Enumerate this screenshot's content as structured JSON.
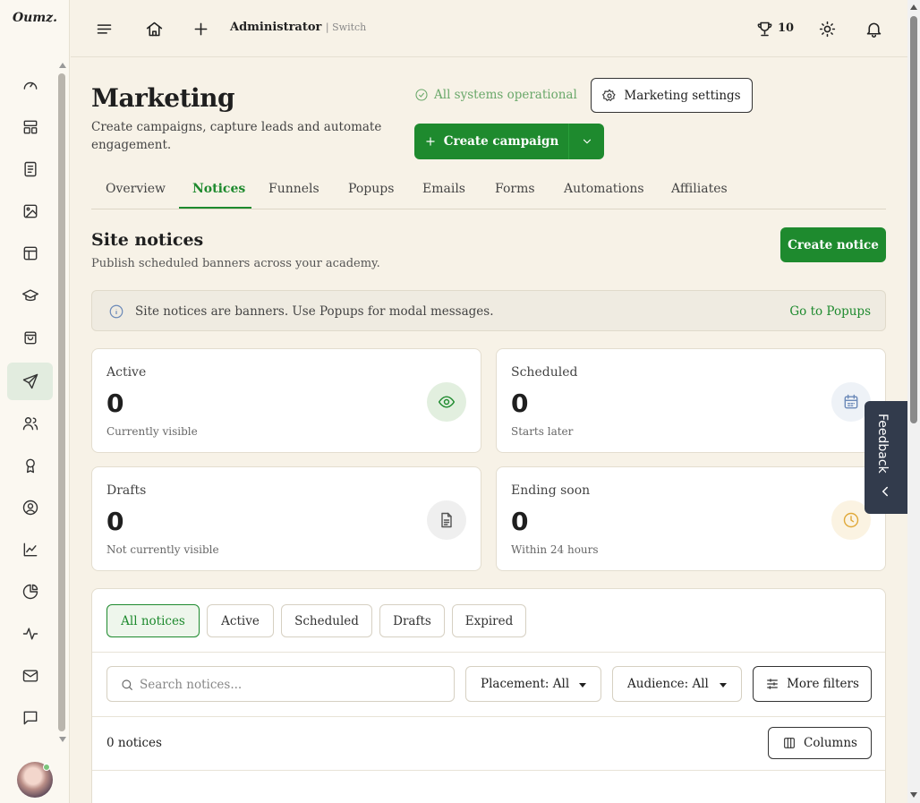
{
  "app": {
    "logo_text": "Oumz."
  },
  "topbar": {
    "user_name": "Administrator",
    "switch_label": "| Switch",
    "trophy_count": "10"
  },
  "header": {
    "title": "Marketing",
    "subtitle": "Create campaigns, capture leads and automate engagement.",
    "status_text": "All systems operational",
    "settings_label": "Marketing settings",
    "create_campaign_label": "Create campaign"
  },
  "tabs": [
    {
      "label": "Overview"
    },
    {
      "label": "Notices"
    },
    {
      "label": "Funnels"
    },
    {
      "label": "Popups"
    },
    {
      "label": "Emails"
    },
    {
      "label": "Forms"
    },
    {
      "label": "Automations"
    },
    {
      "label": "Affiliates"
    }
  ],
  "section": {
    "title": "Site notices",
    "subtitle": "Publish scheduled banners across your academy.",
    "create_label": "Create notice"
  },
  "info": {
    "text": "Site notices are banners. Use Popups for modal messages.",
    "link": "Go to Popups"
  },
  "stats": [
    {
      "label": "Active",
      "value": "0",
      "note": "Currently visible",
      "icon": "eye-icon",
      "color": "#1e8a2e"
    },
    {
      "label": "Scheduled",
      "value": "0",
      "note": "Starts later",
      "icon": "calendar-icon",
      "color": "#6b89b8"
    },
    {
      "label": "Drafts",
      "value": "0",
      "note": "Not currently visible",
      "icon": "document-icon",
      "color": "#555555"
    },
    {
      "label": "Ending soon",
      "value": "0",
      "note": "Within 24 hours",
      "icon": "clock-icon",
      "color": "#e0a93a"
    }
  ],
  "feedback": {
    "label": "Feedback"
  },
  "notices": {
    "filters": [
      {
        "label": "All notices"
      },
      {
        "label": "Active"
      },
      {
        "label": "Scheduled"
      },
      {
        "label": "Drafts"
      },
      {
        "label": "Expired"
      }
    ],
    "search_placeholder": "Search notices...",
    "placement_label": "Placement: All",
    "audience_label": "Audience: All",
    "more_filters_label": "More filters",
    "count_text": "0 notices",
    "columns_label": "Columns"
  },
  "colors": {
    "accent": "#1e8a2e",
    "background": "#f7f2e7",
    "feedback_bg": "#323b4c"
  }
}
